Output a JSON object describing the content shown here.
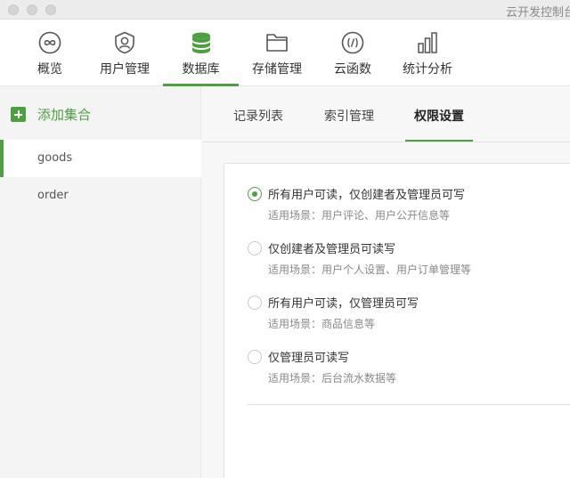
{
  "window": {
    "title": "云开发控制台"
  },
  "nav": {
    "items": [
      {
        "label": "概览",
        "icon": "infinity-icon"
      },
      {
        "label": "用户管理",
        "icon": "user-shield-icon"
      },
      {
        "label": "数据库",
        "icon": "database-icon"
      },
      {
        "label": "存储管理",
        "icon": "folder-icon"
      },
      {
        "label": "云函数",
        "icon": "function-icon"
      },
      {
        "label": "统计分析",
        "icon": "bar-chart-icon"
      }
    ],
    "active_index": 2
  },
  "sidebar": {
    "add_label": "添加集合",
    "collections": [
      {
        "name": "goods"
      },
      {
        "name": "order"
      }
    ],
    "active_index": 0
  },
  "tabs": {
    "items": [
      {
        "label": "记录列表"
      },
      {
        "label": "索引管理"
      },
      {
        "label": "权限设置"
      }
    ],
    "active_index": 2
  },
  "permissions": {
    "selected_index": 0,
    "options": [
      {
        "title": "所有用户可读，仅创建者及管理员可写",
        "desc": "适用场景：用户评论、用户公开信息等"
      },
      {
        "title": "仅创建者及管理员可读写",
        "desc": "适用场景：用户个人设置、用户订单管理等"
      },
      {
        "title": "所有用户可读，仅管理员可写",
        "desc": "适用场景：商品信息等"
      },
      {
        "title": "仅管理员可读写",
        "desc": "适用场景：后台流水数据等"
      }
    ]
  },
  "colors": {
    "accent": "#4ca03f",
    "icon": "#555555"
  }
}
